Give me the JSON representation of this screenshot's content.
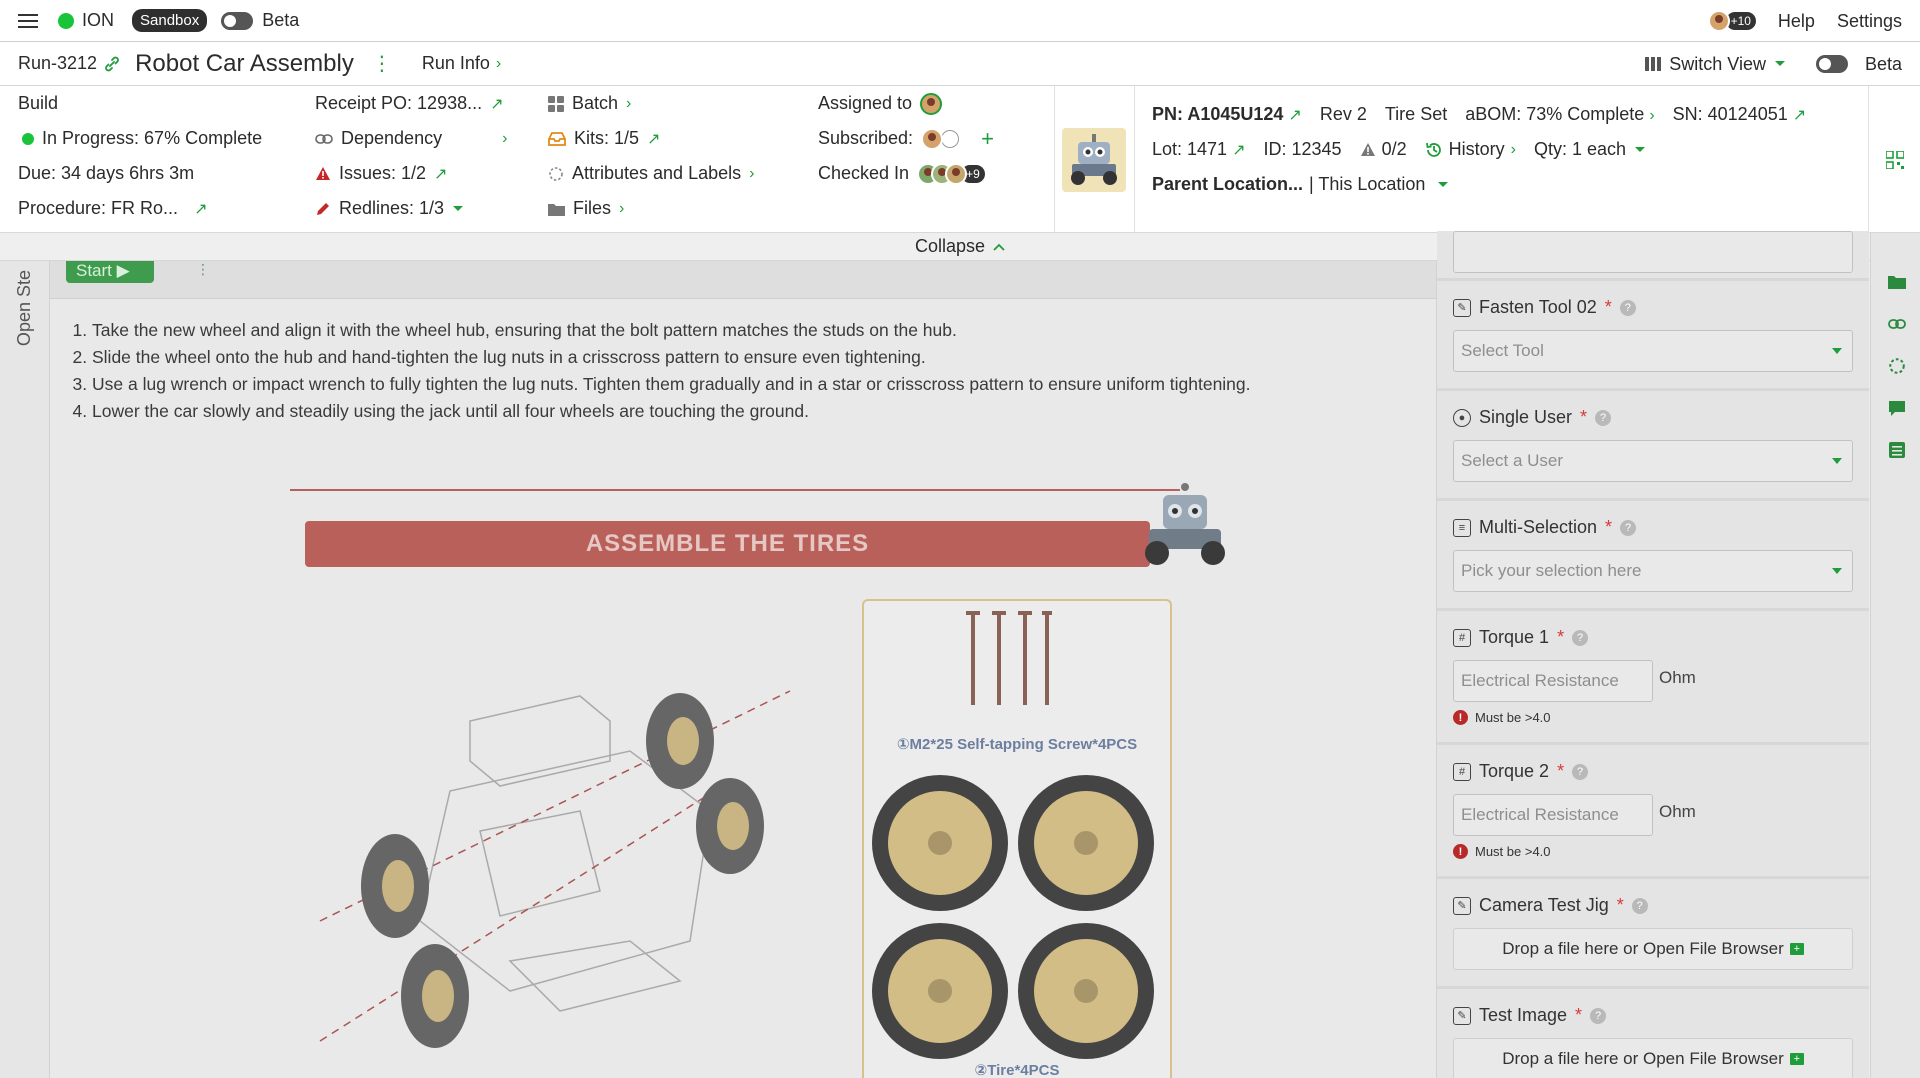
{
  "topbar": {
    "app_name": "ION",
    "env_badge": "Sandbox",
    "beta_label": "Beta",
    "avatar_count": "+10",
    "help": "Help",
    "settings": "Settings"
  },
  "run": {
    "id": "Run-3212",
    "title": "Robot Car Assembly",
    "run_info": "Run Info",
    "switch_view": "Switch View",
    "beta_label": "Beta"
  },
  "info": {
    "build": "Build",
    "status": "In Progress: 67% Complete",
    "due": "Due: 34 days 6hrs 3m",
    "procedure": "Procedure: FR Ro...",
    "receipt_po": "Receipt PO: 12938...",
    "dependency": "Dependency",
    "issues": "Issues: 1/2",
    "redlines": "Redlines: 1/3",
    "batch": "Batch",
    "kits": "Kits: 1/5",
    "attributes": "Attributes and Labels",
    "files": "Files",
    "assigned_to": "Assigned to",
    "subscribed": "Subscribed:",
    "checked_in": "Checked In",
    "checked_in_count": "+9"
  },
  "part": {
    "pn": "PN: A1045U124",
    "rev": "Rev 2",
    "name": "Tire Set",
    "abom": "aBOM: 73% Complete",
    "sn": "SN: 40124051",
    "lot": "Lot: 1471",
    "id": "ID: 12345",
    "warnings": "0/2",
    "history": "History",
    "qty": "Qty: 1 each",
    "parent_location": "Parent Location...",
    "this_location": "| This Location"
  },
  "collapse_label": "Collapse",
  "step": {
    "vertical_label": "Open Ste",
    "start_label": "Start",
    "instructions": [
      "Take the new wheel and align it with the wheel hub, ensuring that the bolt pattern matches the studs on the hub.",
      "Slide the wheel onto the hub and hand-tighten the lug nuts in a crisscross pattern to ensure even tightening.",
      "Use a lug wrench or impact wrench to fully tighten the lug nuts. Tighten them gradually and in a star or crisscross pattern to ensure uniform tightening.",
      "Lower the car slowly and steadily using the jack until all four wheels are touching the ground."
    ],
    "figure": {
      "banner": "ASSEMBLE THE TIRES",
      "screw_label": "①M2*25 Self-tapping Screw*4PCS",
      "tire_label": "②Tire*4PCS"
    }
  },
  "form": {
    "fasten_tool": {
      "label": "Fasten Tool 02",
      "placeholder": "Select Tool"
    },
    "single_user": {
      "label": "Single User",
      "placeholder": "Select a User"
    },
    "multi_selection": {
      "label": "Multi-Selection",
      "placeholder": "Pick your selection here"
    },
    "torque1": {
      "label": "Torque 1",
      "placeholder": "Electrical Resistance",
      "unit": "Ohm",
      "error": "Must be >4.0"
    },
    "torque2": {
      "label": "Torque 2",
      "placeholder": "Electrical Resistance",
      "unit": "Ohm",
      "error": "Must be >4.0"
    },
    "camera_test_jig": {
      "label": "Camera Test Jig",
      "drop_text": "Drop a file here or Open File Browser"
    },
    "test_image": {
      "label": "Test Image",
      "drop_text": "Drop a file here or Open File Browser"
    },
    "required_mark": "*",
    "help_mark": "?"
  },
  "colors": {
    "accent_green": "#1f9d3a",
    "status_green": "#19c43a",
    "error_red": "#b82929",
    "banner_red": "#b9605a"
  }
}
